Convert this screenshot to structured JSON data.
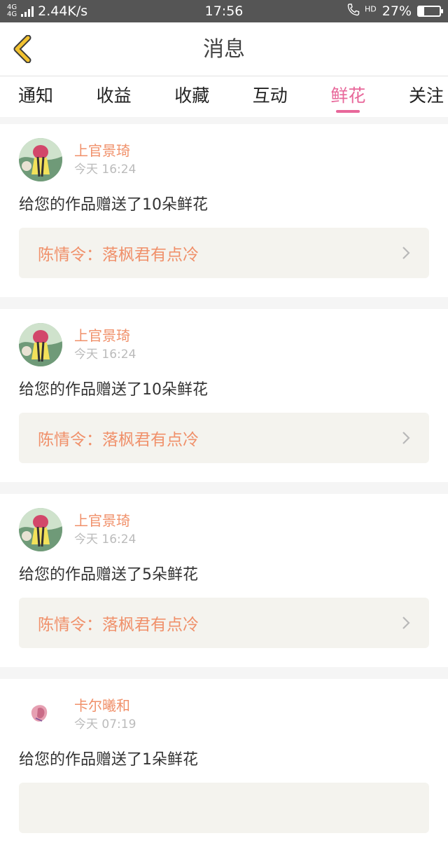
{
  "status_bar": {
    "network": "4G",
    "network2": "4G",
    "speed": "2.44K/s",
    "time": "17:56",
    "hd": "HD",
    "battery_percent": "27%",
    "battery_level": 0.27
  },
  "header": {
    "title": "消息"
  },
  "tabs": [
    {
      "label": "通知"
    },
    {
      "label": "收益"
    },
    {
      "label": "收藏"
    },
    {
      "label": "互动"
    },
    {
      "label": "鲜花",
      "active": true
    },
    {
      "label": "关注"
    }
  ],
  "messages": [
    {
      "user": "上官景琦",
      "time": "今天 16:24",
      "text": "给您的作品赠送了10朵鲜花",
      "work": "陈情令：落枫君有点冷"
    },
    {
      "user": "上官景琦",
      "time": "今天 16:24",
      "text": "给您的作品赠送了10朵鲜花",
      "work": "陈情令：落枫君有点冷"
    },
    {
      "user": "上官景琦",
      "time": "今天 16:24",
      "text": "给您的作品赠送了5朵鲜花",
      "work": "陈情令：落枫君有点冷"
    },
    {
      "user": "卡尔曦和",
      "time": "今天 07:19",
      "text": "给您的作品赠送了1朵鲜花",
      "work": ""
    }
  ],
  "colors": {
    "accent": "#e8679a",
    "name": "#f0906a",
    "back_icon": "#f2c230"
  }
}
